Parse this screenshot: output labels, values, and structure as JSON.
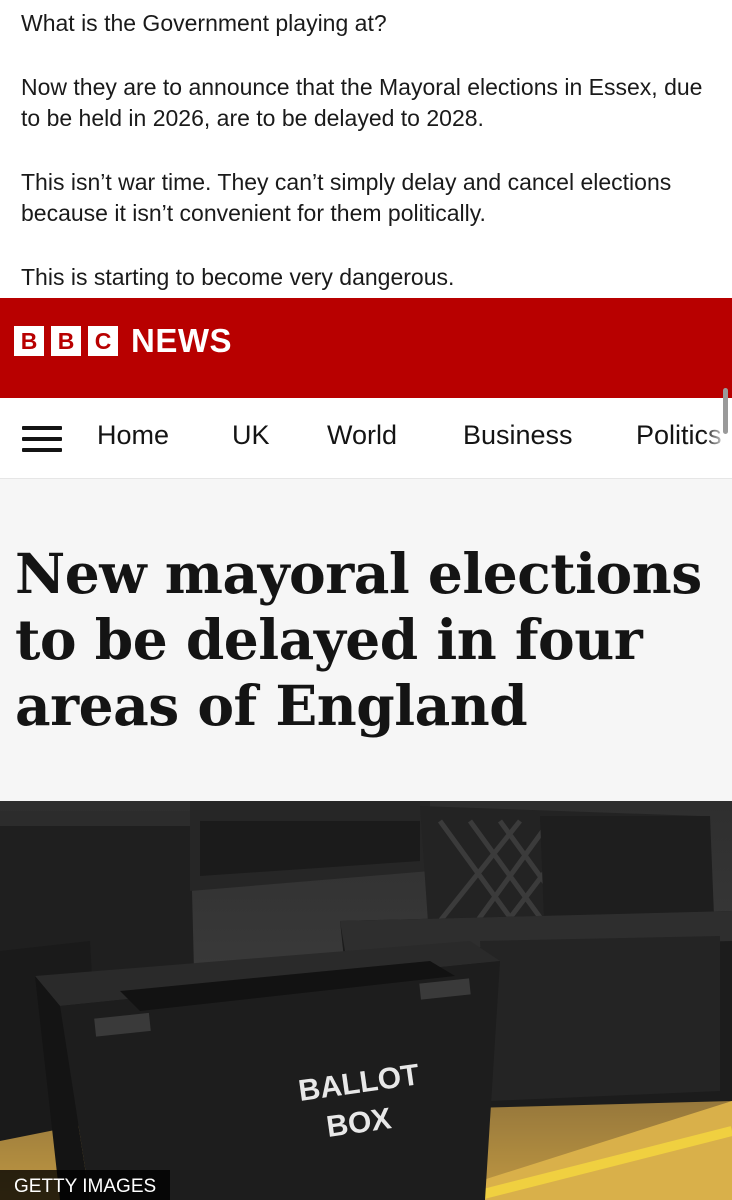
{
  "post": {
    "paragraphs": [
      "What is the Government playing at?",
      "Now they are to announce that the Mayoral elections in Essex, due to be held in 2026, are to be delayed to 2028.",
      "This isn’t war time. They can’t simply delay and cancel elections because it isn’t convenient for them politically.",
      "This is starting to become very dangerous."
    ]
  },
  "bbc": {
    "logo_letters": [
      "B",
      "B",
      "C"
    ],
    "news_word": "NEWS",
    "brand_color": "#b80000"
  },
  "nav": {
    "menu_icon": "hamburger-menu-icon",
    "items": [
      "Home",
      "UK",
      "World",
      "Business",
      "Politics"
    ]
  },
  "article": {
    "headline": "New mayoral elections to be delayed in four areas of England",
    "image": {
      "box_label_line1": "BALLOT",
      "box_label_line2": "BOX",
      "credit": "GETTY IMAGES"
    }
  }
}
